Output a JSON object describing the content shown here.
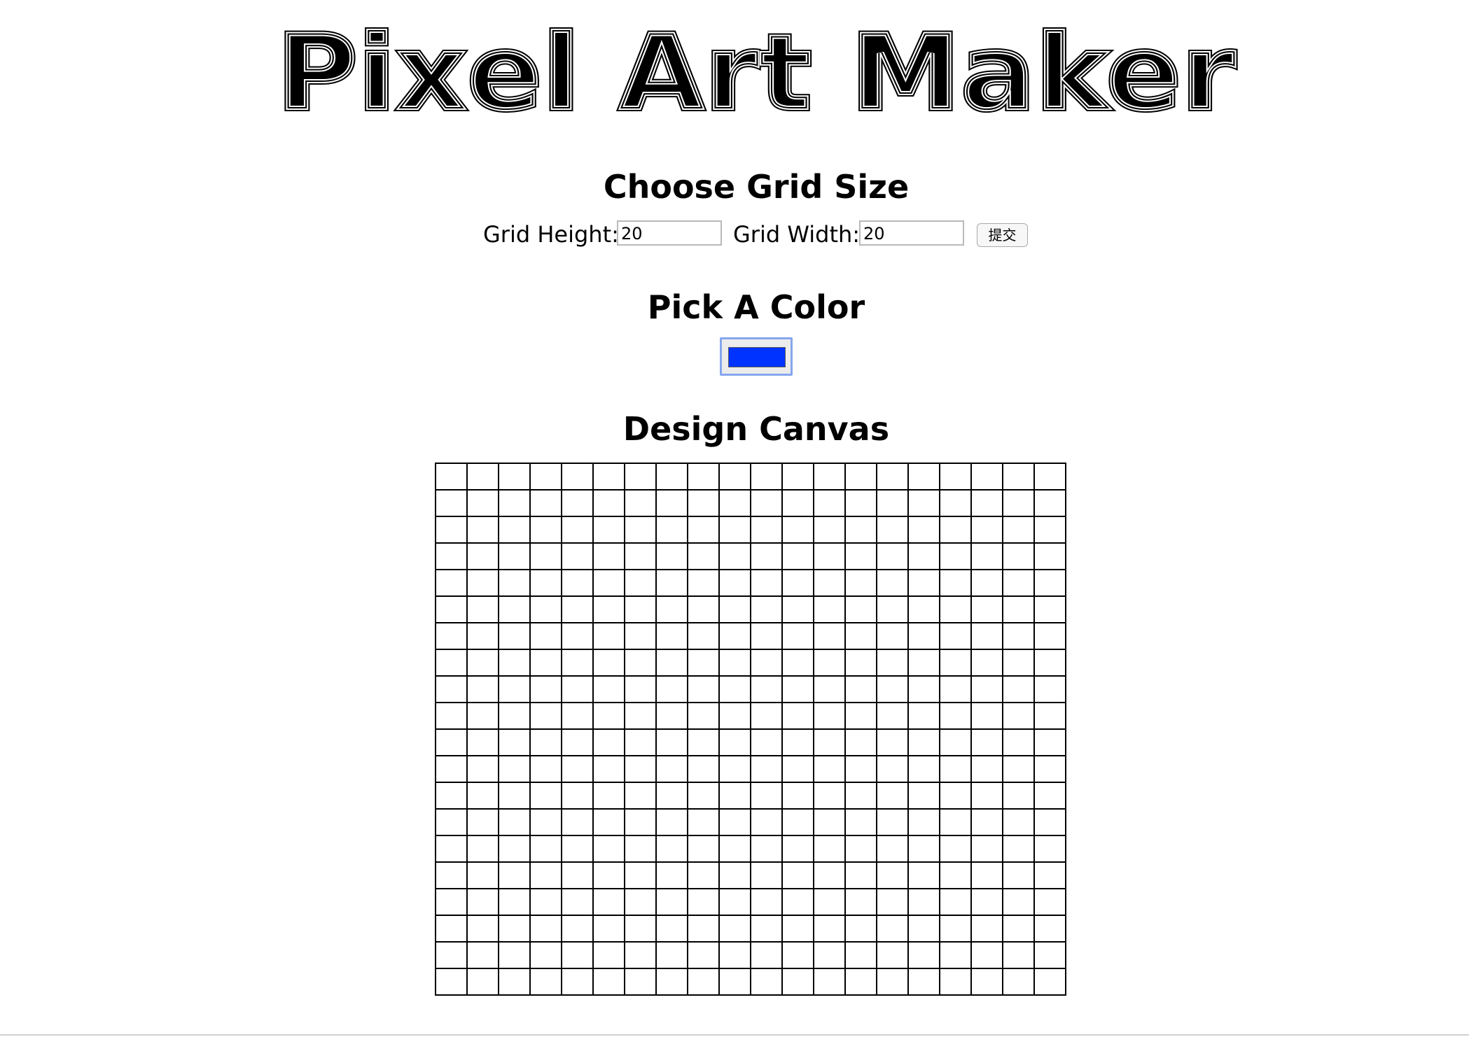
{
  "page": {
    "title": "Pixel Art Maker"
  },
  "grid_size_section": {
    "heading": "Choose Grid Size",
    "height_label": "Grid Height:",
    "height_value": "20",
    "width_label": "Grid Width:",
    "width_value": "20",
    "submit_label": "提交"
  },
  "color_section": {
    "heading": "Pick A Color",
    "selected_color": "#0033ff",
    "focus_ring_color": "#86a6ee"
  },
  "canvas_section": {
    "heading": "Design Canvas",
    "rows": 20,
    "columns": 20,
    "cell_color": "#ffffff",
    "grid_line_color": "#000000"
  }
}
